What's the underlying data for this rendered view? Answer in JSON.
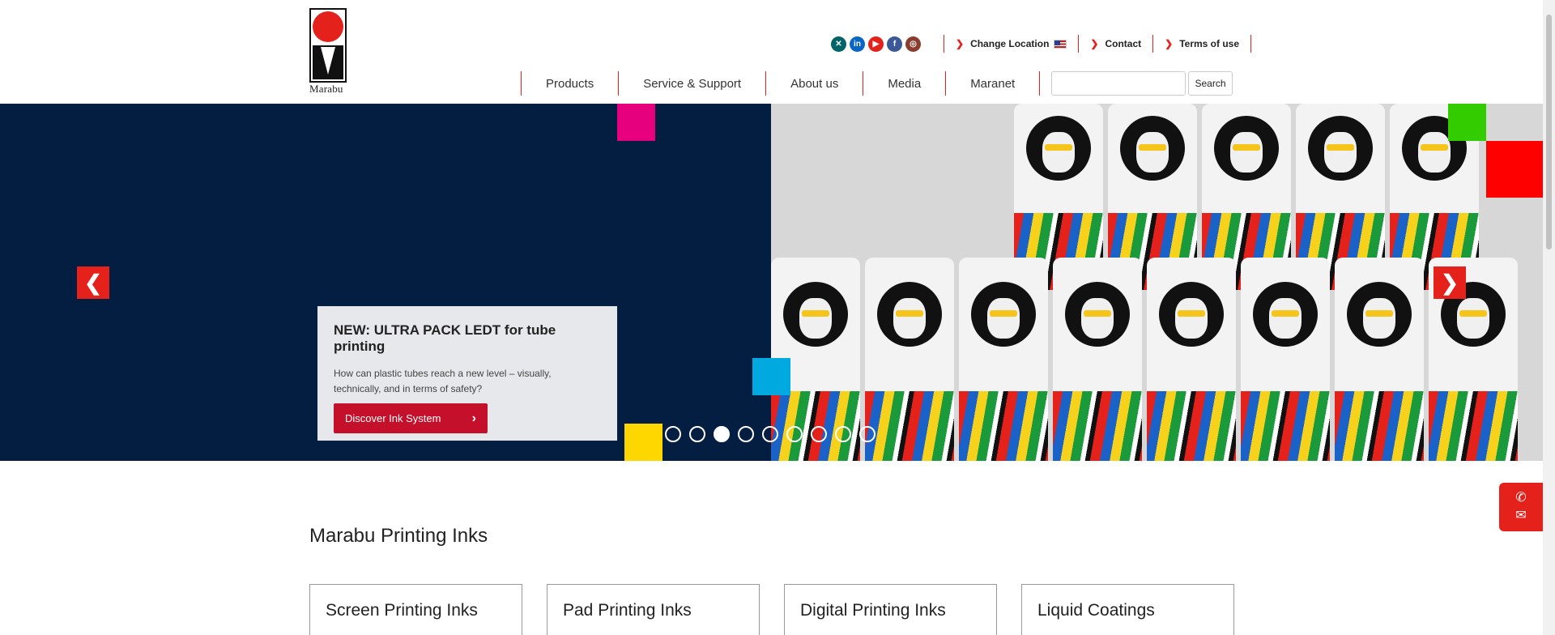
{
  "brand": {
    "name": "Marabu"
  },
  "social": [
    {
      "icon": "xing-icon",
      "glyph": "✕",
      "color": "#026466"
    },
    {
      "icon": "linkedin-icon",
      "glyph": "in",
      "color": "#0a66c2"
    },
    {
      "icon": "youtube-icon",
      "glyph": "▶",
      "color": "#e4211b"
    },
    {
      "icon": "facebook-icon",
      "glyph": "f",
      "color": "#3b5998"
    },
    {
      "icon": "instagram-icon",
      "glyph": "◎",
      "color": "#8a3c2e"
    }
  ],
  "utility": {
    "change_location": "Change Location",
    "contact": "Contact",
    "terms": "Terms of use"
  },
  "nav": {
    "products": "Products",
    "service": "Service & Support",
    "about": "About us",
    "media": "Media",
    "maranet": "Maranet"
  },
  "search": {
    "value": "",
    "button": "Search"
  },
  "hero": {
    "title": "NEW: ULTRA PACK LEDT for tube printing",
    "text": "How can plastic tubes reach a new level – visually, technically, and in terms of safety?",
    "cta": "Discover Ink System",
    "prev": "❮",
    "next": "❯",
    "slides_total": 9,
    "active_slide": 3
  },
  "section": {
    "title": "Marabu Printing Inks"
  },
  "cards": [
    {
      "title": "Screen Printing Inks"
    },
    {
      "title": "Pad Printing Inks"
    },
    {
      "title": "Digital Printing Inks"
    },
    {
      "title": "Liquid Coatings"
    }
  ],
  "colors": {
    "accent": "#e4211b",
    "hero_bg": "#041e42",
    "cta": "#c4102b",
    "magenta": "#e6007e",
    "cyan": "#00a9e0",
    "yellow": "#ffd700",
    "green": "#33cc00"
  }
}
